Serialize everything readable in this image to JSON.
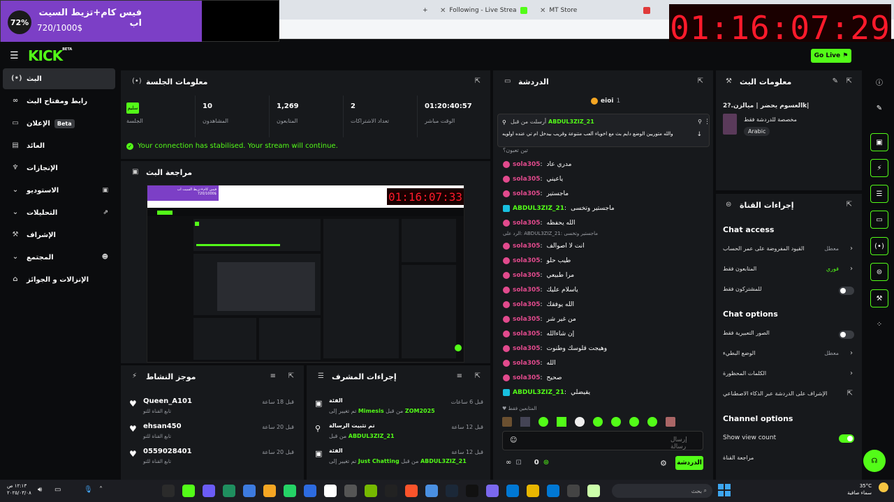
{
  "browser": {
    "tabs": [
      {
        "label": "Following - Live Streams on Kick",
        "color": "#53fc18"
      },
      {
        "label": "MT Store",
        "color": "#e03a3a"
      }
    ]
  },
  "goal": {
    "percent": "72%",
    "title": "فيس كام+تزيط السيت اب",
    "amount": "720/1000$"
  },
  "timer": "01:16:07:29",
  "header": {
    "logo": "KICK",
    "logo_badge": "BETA",
    "go_live": "Go Live"
  },
  "sidebar": {
    "items": [
      {
        "label": "البث",
        "icon": "(•)"
      },
      {
        "label": "رابط ومفتاح البث",
        "icon": "∞"
      },
      {
        "label": "الإعلان",
        "icon": "▭",
        "badge": "Beta"
      },
      {
        "label": "العائد",
        "icon": "▤"
      },
      {
        "label": "الإنجازات",
        "icon": "♆"
      },
      {
        "label": "الاستوديو",
        "icon": "▣"
      },
      {
        "label": "التحليلات",
        "icon": "⇗"
      },
      {
        "label": "الإشراف",
        "icon": "⚒"
      },
      {
        "label": "المجتمع",
        "icon": "☻"
      },
      {
        "label": "الإنزالات و الجوائز",
        "icon": "⌂"
      }
    ]
  },
  "session": {
    "title": "معلومات الجلسة",
    "healthy": "سليم",
    "healthy_label": "الجلسة",
    "stats": [
      {
        "value": "10",
        "label": "المشاهدون"
      },
      {
        "value": "1,269",
        "label": "المتابعون"
      },
      {
        "value": "2",
        "label": "تعداد الاشتراكات"
      },
      {
        "value": "01:20:40:57",
        "label": "الوقت مباشر"
      }
    ],
    "status": "Your connection has stabilised. Your stream will continue."
  },
  "preview": {
    "title": "مراجعة البث",
    "goal": "فيس كام+تزيط السيت اب",
    "goal_amount": "720/1000$",
    "goal_pct": "72%",
    "timer": "01:16:07:33"
  },
  "activity": {
    "title": "موجز النشاط",
    "items": [
      {
        "name": "Queen_A101",
        "sub": "تابع القناة للتو",
        "time": "قبل 18 ساعة"
      },
      {
        "name": "ehsan450",
        "sub": "تابع القناة للتو",
        "time": "قبل 20 ساعة"
      },
      {
        "name": "0559028401",
        "sub": "تابع القناة للتو",
        "time": "قبل 20 ساعة"
      }
    ]
  },
  "modactions": {
    "title": "إجراءات المشرف",
    "items": [
      {
        "icon": "▣",
        "title": "الفئة",
        "pre": "تم تغيير إلى",
        "hl1": "Mimesis",
        "mid": "من قبل",
        "hl2": "ZOM2025",
        "time": "قبل 6 ساعات"
      },
      {
        "icon": "⚲",
        "title": "تم تثبيت الرسالة",
        "pre": "من قبل",
        "hl1": "ABDUL3ZIZ_21",
        "mid": "",
        "hl2": "",
        "time": "قبل 12 ساعة"
      },
      {
        "icon": "▣",
        "title": "الفئة",
        "pre": "تم تغيير إلى",
        "hl1": "Just Chatting",
        "mid": "من قبل",
        "hl2": "ABDUL3ZIZ_21",
        "time": "قبل 12 ساعة"
      }
    ]
  },
  "chat": {
    "title": "الدردشة",
    "top_user": "eioi",
    "top_count": "1",
    "pinned_by": "أرسلت من قبل",
    "pinned_user": "ABDUL3ZIZ_21",
    "pinned_text": "والله متوريين الوضع دايم بث مع اخوياء ألعب متنوعة وقريب بيدخل ام تي عنده اولويه",
    "pinned_trail": "تين تعبون؟",
    "messages": [
      {
        "user": "sola305",
        "text": "مدري عاد",
        "kind": "pink"
      },
      {
        "user": "sola305",
        "text": "ياعيني",
        "kind": "pink"
      },
      {
        "user": "sola305",
        "text": "ماجستير",
        "kind": "pink"
      },
      {
        "user": "ABDUL3ZIZ_21",
        "text": "ماجستير وتخسى",
        "kind": "green"
      },
      {
        "user": "sola305",
        "text": "الله يحفظه",
        "kind": "pink"
      },
      {
        "user": "sola305",
        "text": "انت لا اصوالف",
        "kind": "pink",
        "reply": "الرد على: ABDUL3ZIZ_21: ماجستير وتخسى"
      },
      {
        "user": "sola305",
        "text": "طيب حلو",
        "kind": "pink"
      },
      {
        "user": "sola305",
        "text": "مرا طبيعي",
        "kind": "pink"
      },
      {
        "user": "sola305",
        "text": "ياسلام عليك",
        "kind": "pink"
      },
      {
        "user": "sola305",
        "text": "الله يوفقك",
        "kind": "pink"
      },
      {
        "user": "sola305",
        "text": "من غير شر",
        "kind": "pink"
      },
      {
        "user": "sola305",
        "text": "إن شاءالله",
        "kind": "pink"
      },
      {
        "user": "sola305",
        "text": "وهيجت قلوسك وطنوت",
        "kind": "pink"
      },
      {
        "user": "sola305",
        "text": "الله",
        "kind": "pink"
      },
      {
        "user": "sola305",
        "text": "صحيح",
        "kind": "pink"
      },
      {
        "user": "ABDUL3ZIZ_21",
        "text": "يقيضلي",
        "kind": "green"
      }
    ],
    "followers_only": "المتابعين فقط",
    "placeholder": "إرسال رسالة",
    "points": "0",
    "send": "الدردشة"
  },
  "streaminfo": {
    "title": "معلومات البث",
    "stream_title": "العسوم يحضر | ميالزن.?2k|",
    "category": "مخصصة للدردشة فقط",
    "language": "Arabic"
  },
  "channel_actions": {
    "title": "إجراءات القناة",
    "chat_access": "Chat access",
    "chat_access_rows": [
      {
        "label": "القيود المفروضة على عمر الحساب",
        "value": "معطل",
        "type": "arrow"
      },
      {
        "label": "المتابعون فقط",
        "value": "فوري",
        "type": "arrow",
        "green": true
      },
      {
        "label": "للمشتركون فقط",
        "value": "",
        "type": "toggle",
        "on": false
      }
    ],
    "chat_options": "Chat options",
    "chat_options_rows": [
      {
        "label": "الصور التعبيرية فقط",
        "value": "",
        "type": "toggle",
        "on": false
      },
      {
        "label": "الوضع البطيء",
        "value": "معطل",
        "type": "arrow"
      },
      {
        "label": "الكلمات المحظورة",
        "value": "",
        "type": "arrow"
      },
      {
        "label": "الإشراف على الدردشة عبر الذكاء الاصطناعي",
        "value": "",
        "type": "ext"
      }
    ],
    "channel_options": "Channel options",
    "show_view_count": "Show view count",
    "show_view_count_on": true,
    "channel_review": "مراجعة القناة"
  },
  "taskbar": {
    "search": "بحث",
    "time": "١٢:١٣ ص",
    "date": "٢٠٢٥/٠٣/٠٨",
    "weather_temp": "35°C",
    "weather_desc": "سماء صافية"
  }
}
